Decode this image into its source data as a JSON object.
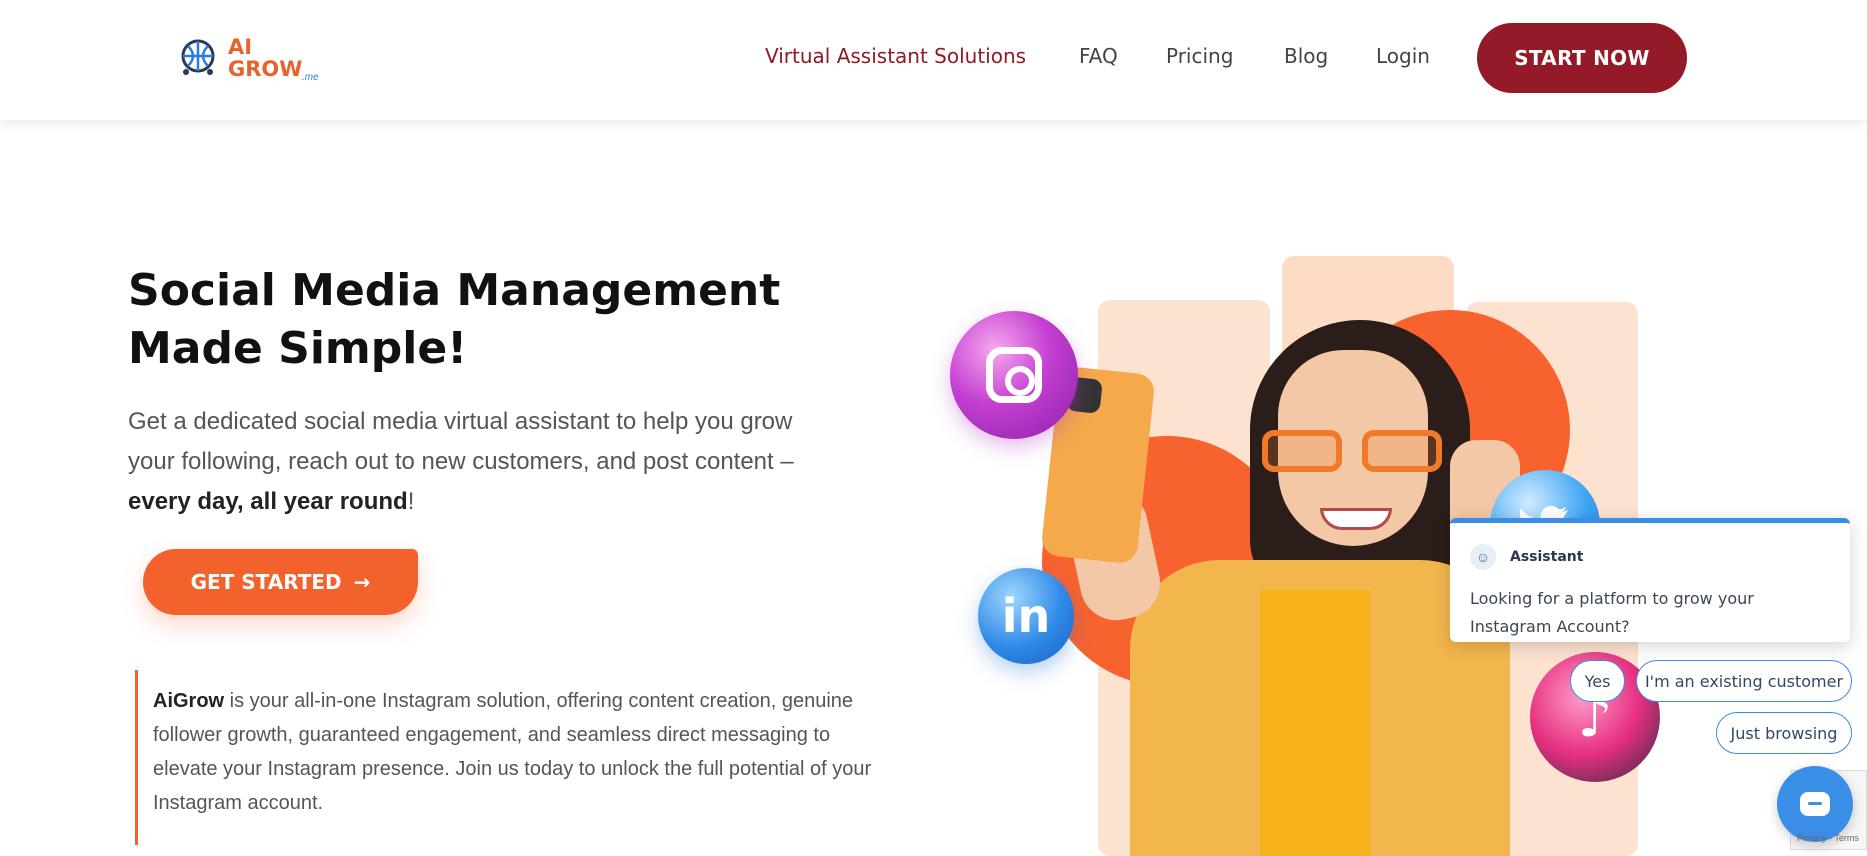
{
  "header": {
    "logo": {
      "line1": "AI",
      "line2": "GROW",
      "suffix": ".me"
    },
    "nav": {
      "virtual_assistant": "Virtual Assistant Solutions",
      "faq": "FAQ",
      "pricing": "Pricing",
      "blog": "Blog",
      "login": "Login"
    },
    "cta": "START NOW"
  },
  "hero": {
    "title_line1": "Social Media Management",
    "title_line2": "Made Simple!",
    "desc_line1": "Get a dedicated social media virtual assistant to help you grow",
    "desc_line2": "your following, reach out to new customers, and post content –",
    "desc_bold": "every day, all year round",
    "desc_end": "!",
    "cta": "GET STARTED",
    "cta_arrow": "→",
    "quote_brand": "AiGrow",
    "quote_text": " is your all-in-one Instagram solution, offering content creation, genuine follower growth, guaranteed engagement, and seamless direct messaging to elevate your Instagram presence. Join us today to unlock the full potential of your Instagram account."
  },
  "chat": {
    "assistant_name": "Assistant",
    "message": "Looking for a platform to grow your Instagram Account?",
    "options": [
      "Yes",
      "I'm an existing customer",
      "Just browsing"
    ]
  },
  "recaptcha": {
    "text": "Privacy - Terms"
  },
  "colors": {
    "brand_red": "#951a27",
    "accent_orange": "#f3622d",
    "chat_blue": "#3b8ee6"
  },
  "icons": [
    "instagram-icon",
    "linkedin-icon",
    "twitter-icon",
    "tiktok-icon",
    "chat-launcher-icon",
    "arrow-right-icon",
    "robot-avatar-icon"
  ]
}
